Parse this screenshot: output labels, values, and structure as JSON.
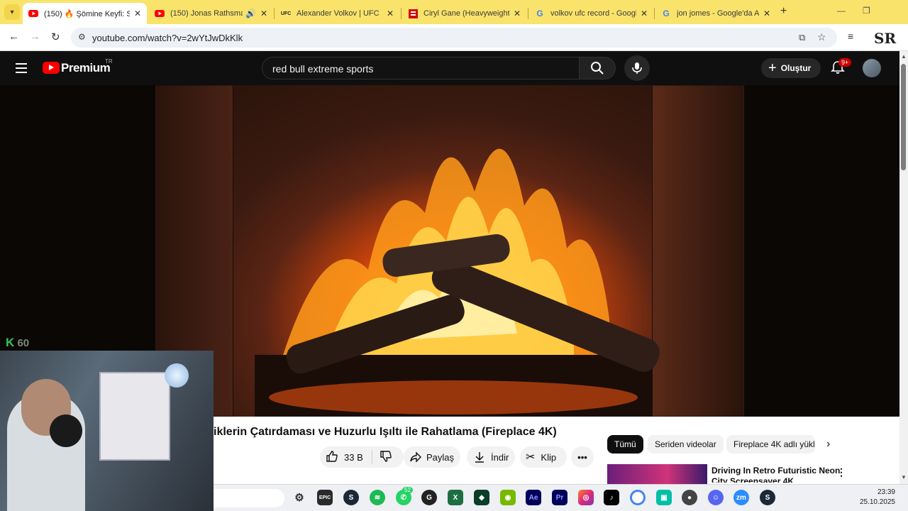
{
  "browser": {
    "tabs": [
      {
        "title": "(150) 🔥 Şömine Keyfi: Sıc",
        "active": true,
        "favicon": "youtube-icon"
      },
      {
        "title": "(150) Jonas Rathsman",
        "active": false,
        "favicon": "youtube-icon",
        "audio": true
      },
      {
        "title": "Alexander Volkov | UFC",
        "active": false,
        "favicon": "ufc-icon"
      },
      {
        "title": "Ciryl Gane (Heavyweight) |",
        "active": false,
        "favicon": "ufc-red-icon"
      },
      {
        "title": "volkov ufc record - Google",
        "active": false,
        "favicon": "google-icon"
      },
      {
        "title": "jon jomes - Google'da Ara",
        "active": false,
        "favicon": "google-icon"
      }
    ],
    "url": "youtube.com/watch?v=2wYtJwDkKlk",
    "profile_logo": "SR"
  },
  "youtube": {
    "brand": "Premium",
    "region": "TR",
    "search_query": "red bull extreme sports",
    "create_label": "Oluştur",
    "notification_badge": "9+",
    "video_title": "iklerin Çatırdaması ve Huzurlu Işıltı ile Rahatlama (Fireplace 4K)",
    "like_count": "33 B",
    "share_label": "Paylaş",
    "download_label": "İndir",
    "clip_label": "Klip",
    "chips": [
      "Tümü",
      "Seriden videolar",
      "Fireplace 4K adlı yükl"
    ],
    "recommended_title": "Driving In Retro Futuristic Neon City Screensaver 4K"
  },
  "overlay": {
    "fps_logo": "K",
    "fps_value": "60"
  },
  "taskbar": {
    "whatsapp_badge": "52",
    "time": "23:39",
    "date": "25.10.2025"
  }
}
